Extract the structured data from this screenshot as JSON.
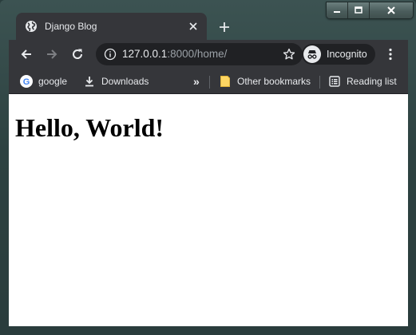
{
  "browser": {
    "tab": {
      "title": "Django Blog"
    },
    "address": {
      "host": "127.0.0.1",
      "rest": ":8000/home/"
    },
    "profile_label": "Incognito",
    "bookmarks": [
      {
        "label": "google",
        "icon": "google-icon"
      },
      {
        "label": "Downloads",
        "icon": "download-icon"
      }
    ],
    "overflow_label": "»",
    "other_bookmarks_label": "Other bookmarks",
    "reading_list_label": "Reading list"
  },
  "page": {
    "heading": "Hello, World!"
  },
  "colors": {
    "chrome_dark": "#35363a",
    "omnibox_bg": "#202124",
    "text_light": "#e8eaed",
    "text_dim": "#9aa0a6",
    "page_bg": "#ffffff"
  }
}
